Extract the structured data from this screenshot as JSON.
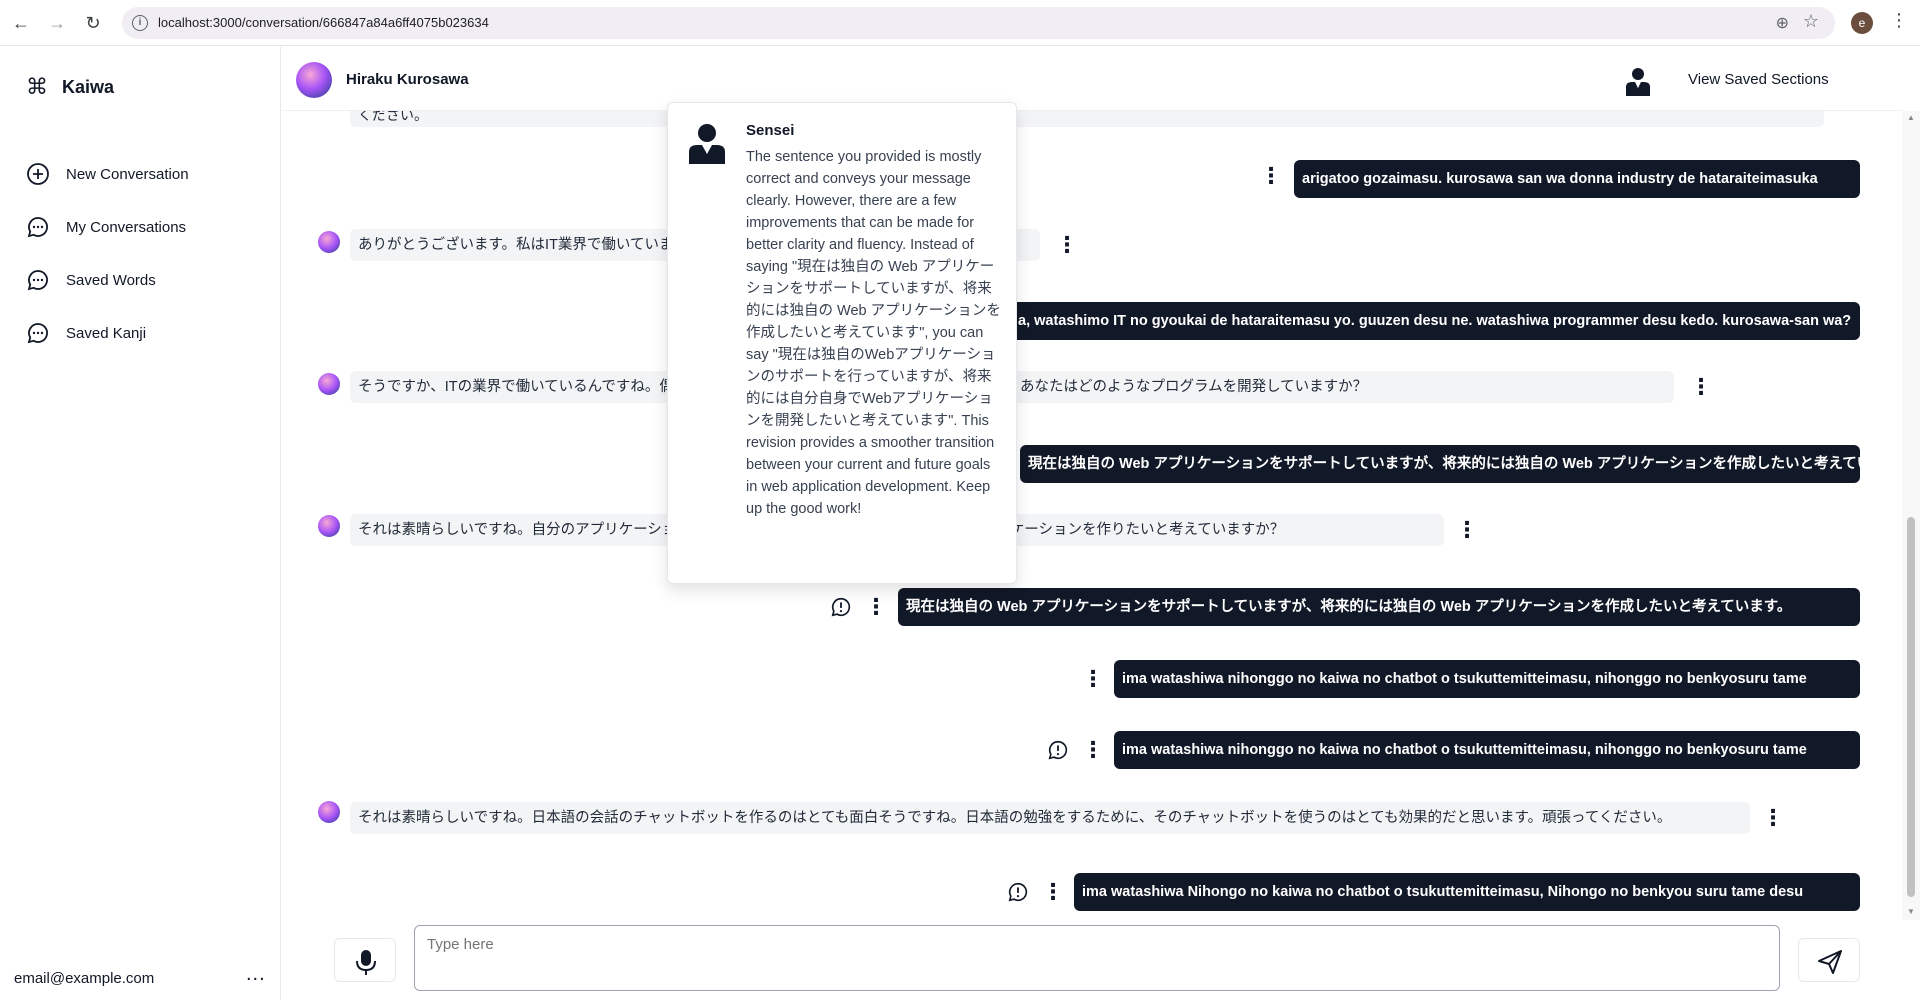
{
  "browser": {
    "url": "localhost:3000/conversation/666847a84a6ff4075b023634",
    "profile_initial": "e"
  },
  "sidebar": {
    "brand": "Kaiwa",
    "items": [
      {
        "label": "New Conversation",
        "icon": "plus-circle-icon"
      },
      {
        "label": "My Conversations",
        "icon": "chat-bubble-icon"
      },
      {
        "label": "Saved Words",
        "icon": "chat-bubble-icon"
      },
      {
        "label": "Saved Kanji",
        "icon": "chat-bubble-icon"
      }
    ],
    "user_email": "email@example.com",
    "more_label": "..."
  },
  "header": {
    "name": "Hiraku Kurosawa",
    "view_saved_label": "View Saved Sections"
  },
  "messages": {
    "partial_top": "ください。",
    "m1_user": "arigatoo gozaimasu. kurosawa san wa donna industry de hataraiteimasuka",
    "m2_bot": "ありがとうございます。私はIT業界で働いています。あなたはどのような業界で働いていますか？",
    "m3_user": "a, watashimo IT no gyoukai de hataraitemasu yo. guuzen desu ne. watashiwa programmer desu kedo. kurosawa-san wa?",
    "m4_bot": "そうですか、ITの業界で働いているんですね。偶然ですね。私はソフトウェア開発を担当しています。あなたはどのようなプログラムを開発していますか？",
    "m5_user": "現在は独自の Web アプリケーションをサポートしていますが、将来的には独自の Web アプリケーションを作成したいと考えています。",
    "m6_bot": "それは素晴らしいですね。自分のアプリケーションを作るのは素晴らしい目標ですね。どんなアプリケーションを作りたいと考えていますか？",
    "m7_user": "現在は独自の Web アプリケーションをサポートしていますが、将来的には独自の Web アプリケーションを作成したいと考えています。",
    "m8_user": "ima watashiwa nihonggo no kaiwa no chatbot o tsukuttemitteimasu, nihonggo no benkyosuru tame",
    "m9_user": "ima watashiwa nihonggo no kaiwa no chatbot o tsukuttemitteimasu, nihonggo no benkyosuru tame",
    "m10_bot": "それは素晴らしいですね。日本語の会話のチャットボットを作るのはとても面白そうですね。日本語の勉強をするために、そのチャットボットを使うのはとても効果的だと思います。頑張ってください。",
    "m11_user": "ima watashiwa Nihongo no kaiwa no chatbot o tsukuttemitteimasu, Nihongo no benkyou suru tame desu"
  },
  "sensei": {
    "name": "Sensei",
    "feedback": "The sentence you provided is mostly correct and conveys your message clearly. However, there are a few improvements that can be made for better clarity and fluency. Instead of saying \"現在は独自の Web アプリケーションをサポートしていますが、将来的には独自の Web アプリケーションを作成したいと考えています\", you can say \"現在は独自のWebアプリケーションのサポートを行っていますが、将来的には自分自身でWebアプリケーションを開発したいと考えています\". This revision provides a smoother transition between your current and future goals in web application development. Keep up the good work!"
  },
  "composer": {
    "placeholder": "Type here"
  },
  "colors": {
    "user_bubble": "#111827",
    "bot_bubble": "#f3f4f6"
  }
}
